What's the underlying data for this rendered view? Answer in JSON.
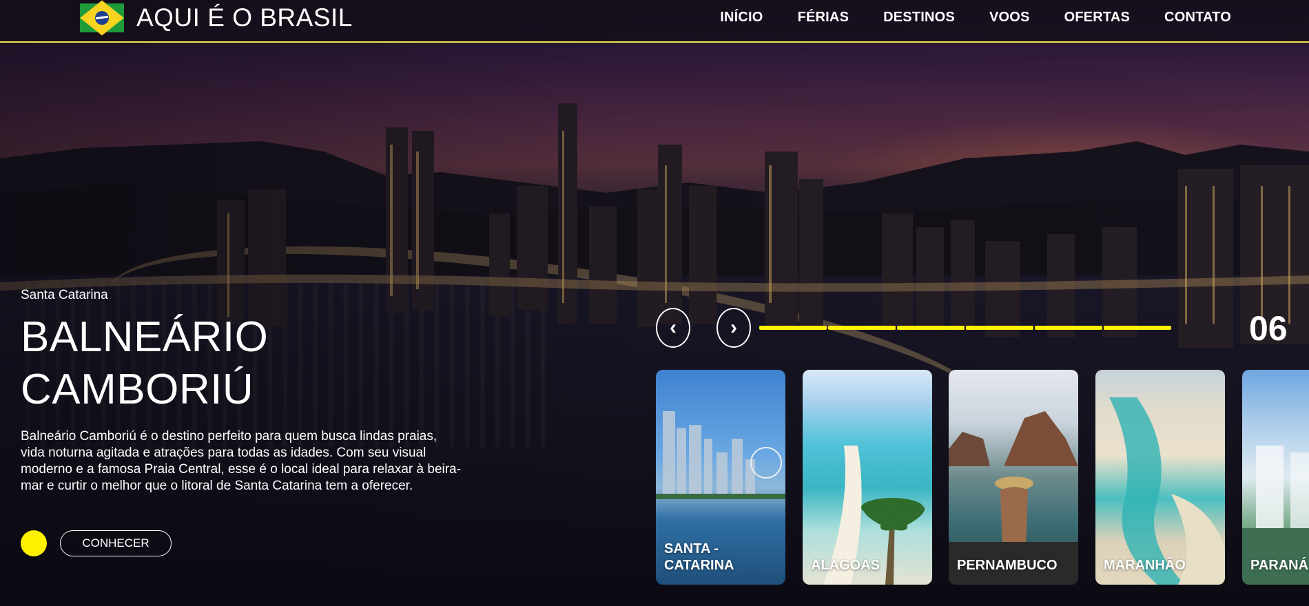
{
  "header": {
    "brand": "AQUI É O BRASIL",
    "nav": [
      "INÍCIO",
      "FÉRIAS",
      "DESTINOS",
      "VOOS",
      "OFERTAS",
      "CONTATO"
    ]
  },
  "hero": {
    "region": "Santa Catarina",
    "title_line1": "BALNEÁRIO",
    "title_line2": "CAMBORIÚ",
    "description": "Balneário Camboriú é o destino perfeito para quem busca lindas praias, vida noturna agitada e atrações para todas as idades. Com seu visual moderno e a famosa Praia Central, esse é o local ideal para relaxar à beira-mar e curtir o melhor que o litoral de Santa Catarina tem a oferecer.",
    "cta_label": "CONHECER"
  },
  "slider": {
    "prev_icon": "‹",
    "next_icon": "›",
    "current": "06"
  },
  "cards": [
    {
      "label": "SANTA - CATARINA"
    },
    {
      "label": "ALAGOAS"
    },
    {
      "label": "PERNAMBUCO"
    },
    {
      "label": "MARANHÃO"
    },
    {
      "label": "PARANÁ"
    }
  ],
  "colors": {
    "accent": "#fff200",
    "header_border": "#f0e84a"
  }
}
